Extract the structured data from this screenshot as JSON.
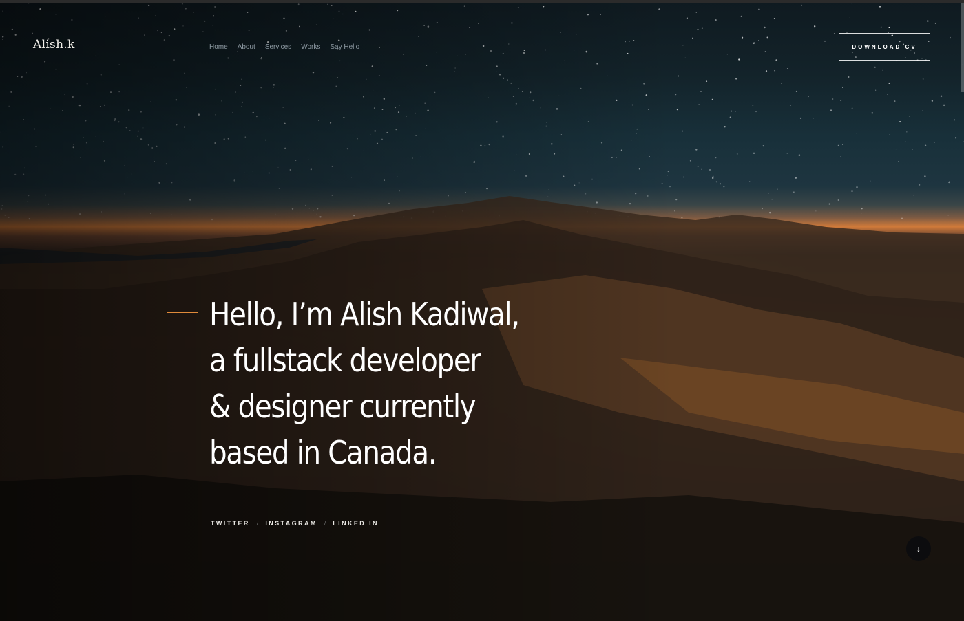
{
  "brand": {
    "logo": "Alish.k"
  },
  "nav": {
    "items": [
      "Home",
      "About",
      "Services",
      "Works",
      "Say Hello"
    ]
  },
  "header": {
    "cv_button": "DOWNLOAD CV"
  },
  "hero": {
    "headline_lines": [
      "Hello, I’m Alish Kadiwal,",
      "a fullstack developer",
      "& designer currently",
      "based in Canada."
    ],
    "accent_color": "#e08a3a"
  },
  "social": {
    "links": [
      "TWITTER",
      "INSTAGRAM",
      "LINKED IN"
    ],
    "separator": "/"
  },
  "scroll": {
    "icon": "arrow-down-icon",
    "glyph": "↓"
  }
}
